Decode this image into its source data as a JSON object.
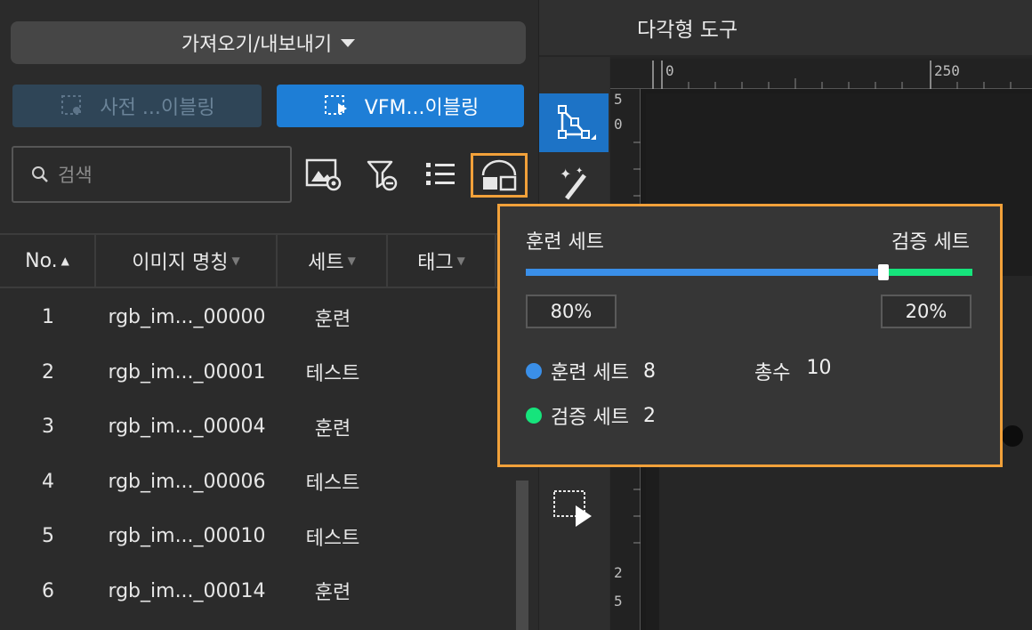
{
  "left_panel": {
    "import_export_label": "가져오기/내보내기",
    "pre_label_button": "사전 ...이블링",
    "vfm_label_button": "VFM...이블링",
    "search_placeholder": "검색"
  },
  "table": {
    "headers": [
      "No.",
      "이미지 명칭",
      "세트",
      "태그"
    ],
    "rows": [
      {
        "no": "1",
        "name": "rgb_im..._00000",
        "set": "훈련"
      },
      {
        "no": "2",
        "name": "rgb_im..._00001",
        "set": "테스트"
      },
      {
        "no": "3",
        "name": "rgb_im..._00004",
        "set": "훈련"
      },
      {
        "no": "4",
        "name": "rgb_im..._00006",
        "set": "테스트"
      },
      {
        "no": "5",
        "name": "rgb_im..._00010",
        "set": "테스트"
      },
      {
        "no": "6",
        "name": "rgb_im..._00014",
        "set": "훈련"
      }
    ]
  },
  "canvas": {
    "title": "다각형 도구",
    "ruler_top": [
      "0",
      "250"
    ],
    "ruler_left_top": [
      "5",
      "0"
    ],
    "ruler_left_bottom": [
      "2",
      "5"
    ]
  },
  "split_popup": {
    "train_label": "훈련 세트",
    "val_label": "검증 세트",
    "train_ratio": 0.8,
    "train_percent": "80%",
    "val_percent": "20%",
    "train_legend": "훈련 세트",
    "train_count": "8",
    "val_legend": "검증 세트",
    "val_count": "2",
    "total_label": "총수",
    "total_count": "10",
    "train_color": "#3a8fe8",
    "val_color": "#16e47c"
  },
  "colors": {
    "accent_blue": "#1e7ed6",
    "highlight_orange": "#f2a13a"
  }
}
